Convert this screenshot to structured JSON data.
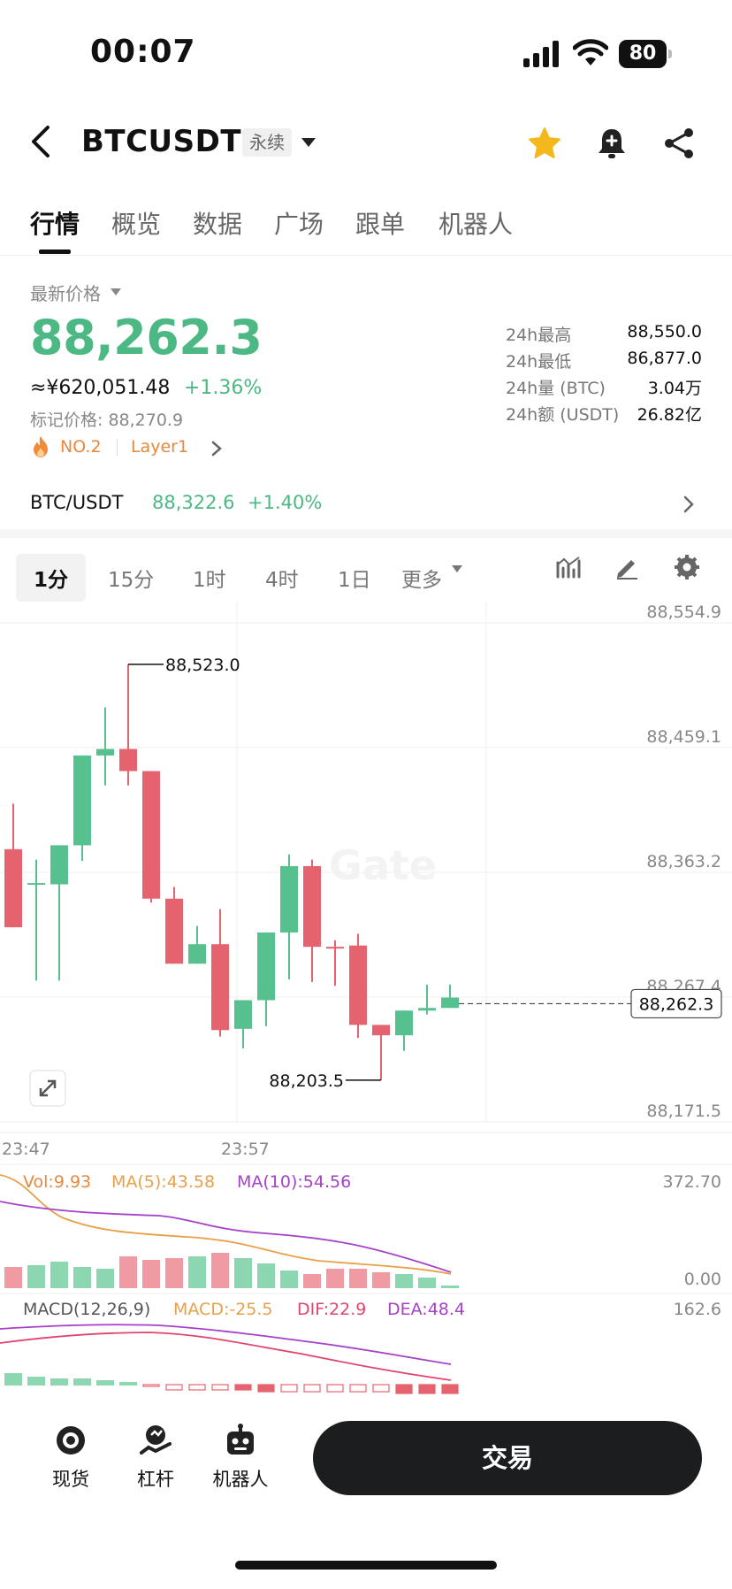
{
  "status_bar": {
    "time": "00:07",
    "battery": "80"
  },
  "header": {
    "symbol": "BTCUSDT",
    "contract_type": "永续",
    "icons": [
      "back-icon",
      "chevron-down-icon",
      "star-icon",
      "bell-icon",
      "share-icon"
    ]
  },
  "tabs": [
    {
      "label": "行情",
      "active": true
    },
    {
      "label": "概览"
    },
    {
      "label": "数据"
    },
    {
      "label": "广场"
    },
    {
      "label": "跟单"
    },
    {
      "label": "机器人"
    }
  ],
  "price": {
    "label": "最新价格",
    "last": "88,262.3",
    "cny": "≈¥620,051.48",
    "change": "+1.36%",
    "mark": "标记价格: 88,270.9",
    "rank": "NO.2",
    "tag": "Layer1"
  },
  "stats": [
    {
      "label": "24h最高",
      "value": "88,550.0"
    },
    {
      "label": "24h最低",
      "value": "86,877.0"
    },
    {
      "label": "24h量 (BTC)",
      "value": "3.04万"
    },
    {
      "label": "24h额 (USDT)",
      "value": "26.82亿"
    }
  ],
  "spot": {
    "symbol": "BTC/USDT",
    "price": "88,322.6",
    "change": "+1.40%"
  },
  "intervals": [
    {
      "label": "1分",
      "active": true
    },
    {
      "label": "15分"
    },
    {
      "label": "1时"
    },
    {
      "label": "4时"
    },
    {
      "label": "1日"
    },
    {
      "label": "更多"
    }
  ],
  "chart_data": {
    "type": "candlestick",
    "y_ticks": [
      "88,554.9",
      "88,459.1",
      "88,363.2",
      "88,267.4",
      "88,171.5"
    ],
    "x_ticks": [
      "23:47",
      "23:57"
    ],
    "high_label": "88,523.0",
    "low_label": "88,203.5",
    "last_label": "88,262.3",
    "watermark": "Gate",
    "colors": {
      "up": "#57c08f",
      "down": "#e5636f"
    },
    "candles": [
      {
        "o": 88381,
        "h": 88416,
        "l": 88329,
        "c": 88321
      },
      {
        "o": 88354,
        "h": 88373,
        "l": 88280,
        "c": 88355
      },
      {
        "o": 88354,
        "h": 88373,
        "l": 88280,
        "c": 88384
      },
      {
        "o": 88384,
        "h": 88451,
        "l": 88372,
        "c": 88453
      },
      {
        "o": 88453,
        "h": 88490,
        "l": 88430,
        "c": 88458
      },
      {
        "o": 88458,
        "h": 88523,
        "l": 88430,
        "c": 88441
      },
      {
        "o": 88441,
        "h": 88438,
        "l": 88340,
        "c": 88343
      },
      {
        "o": 88343,
        "h": 88352,
        "l": 88299,
        "c": 88293
      },
      {
        "o": 88293,
        "h": 88322,
        "l": 88300,
        "c": 88308
      },
      {
        "o": 88308,
        "h": 88335,
        "l": 88237,
        "c": 88242
      },
      {
        "o": 88243,
        "h": 88265,
        "l": 88228,
        "c": 88265
      },
      {
        "o": 88265,
        "h": 88275,
        "l": 88245,
        "c": 88317
      },
      {
        "o": 88317,
        "h": 88377,
        "l": 88281,
        "c": 88368
      },
      {
        "o": 88368,
        "h": 88373,
        "l": 88279,
        "c": 88306
      },
      {
        "o": 88306,
        "h": 88311,
        "l": 88276,
        "c": 88305
      },
      {
        "o": 88307,
        "h": 88316,
        "l": 88236,
        "c": 88246
      },
      {
        "o": 88246,
        "h": 88240,
        "l": 88203.5,
        "c": 88238
      },
      {
        "o": 88238,
        "h": 88256,
        "l": 88226,
        "c": 88257
      },
      {
        "o": 88257,
        "h": 88277,
        "l": 88254,
        "c": 88259
      },
      {
        "o": 88259,
        "h": 88277,
        "l": 88262,
        "c": 88267
      }
    ],
    "volume": {
      "label": "Vol:9.93",
      "ma5": "MA(5):43.58",
      "ma10": "MA(10):54.56",
      "max": "372.70",
      "min": "0.00"
    },
    "macd": {
      "label": "MACD(12,26,9)",
      "macd": "MACD:-25.5",
      "dif": "DIF:22.9",
      "dea": "DEA:48.4",
      "max": "162.6"
    }
  },
  "bottom_nav": [
    {
      "label": "现货",
      "icon": "spot-icon"
    },
    {
      "label": "杠杆",
      "icon": "margin-icon"
    },
    {
      "label": "机器人",
      "icon": "robot-icon"
    }
  ],
  "trade_button": "交易"
}
